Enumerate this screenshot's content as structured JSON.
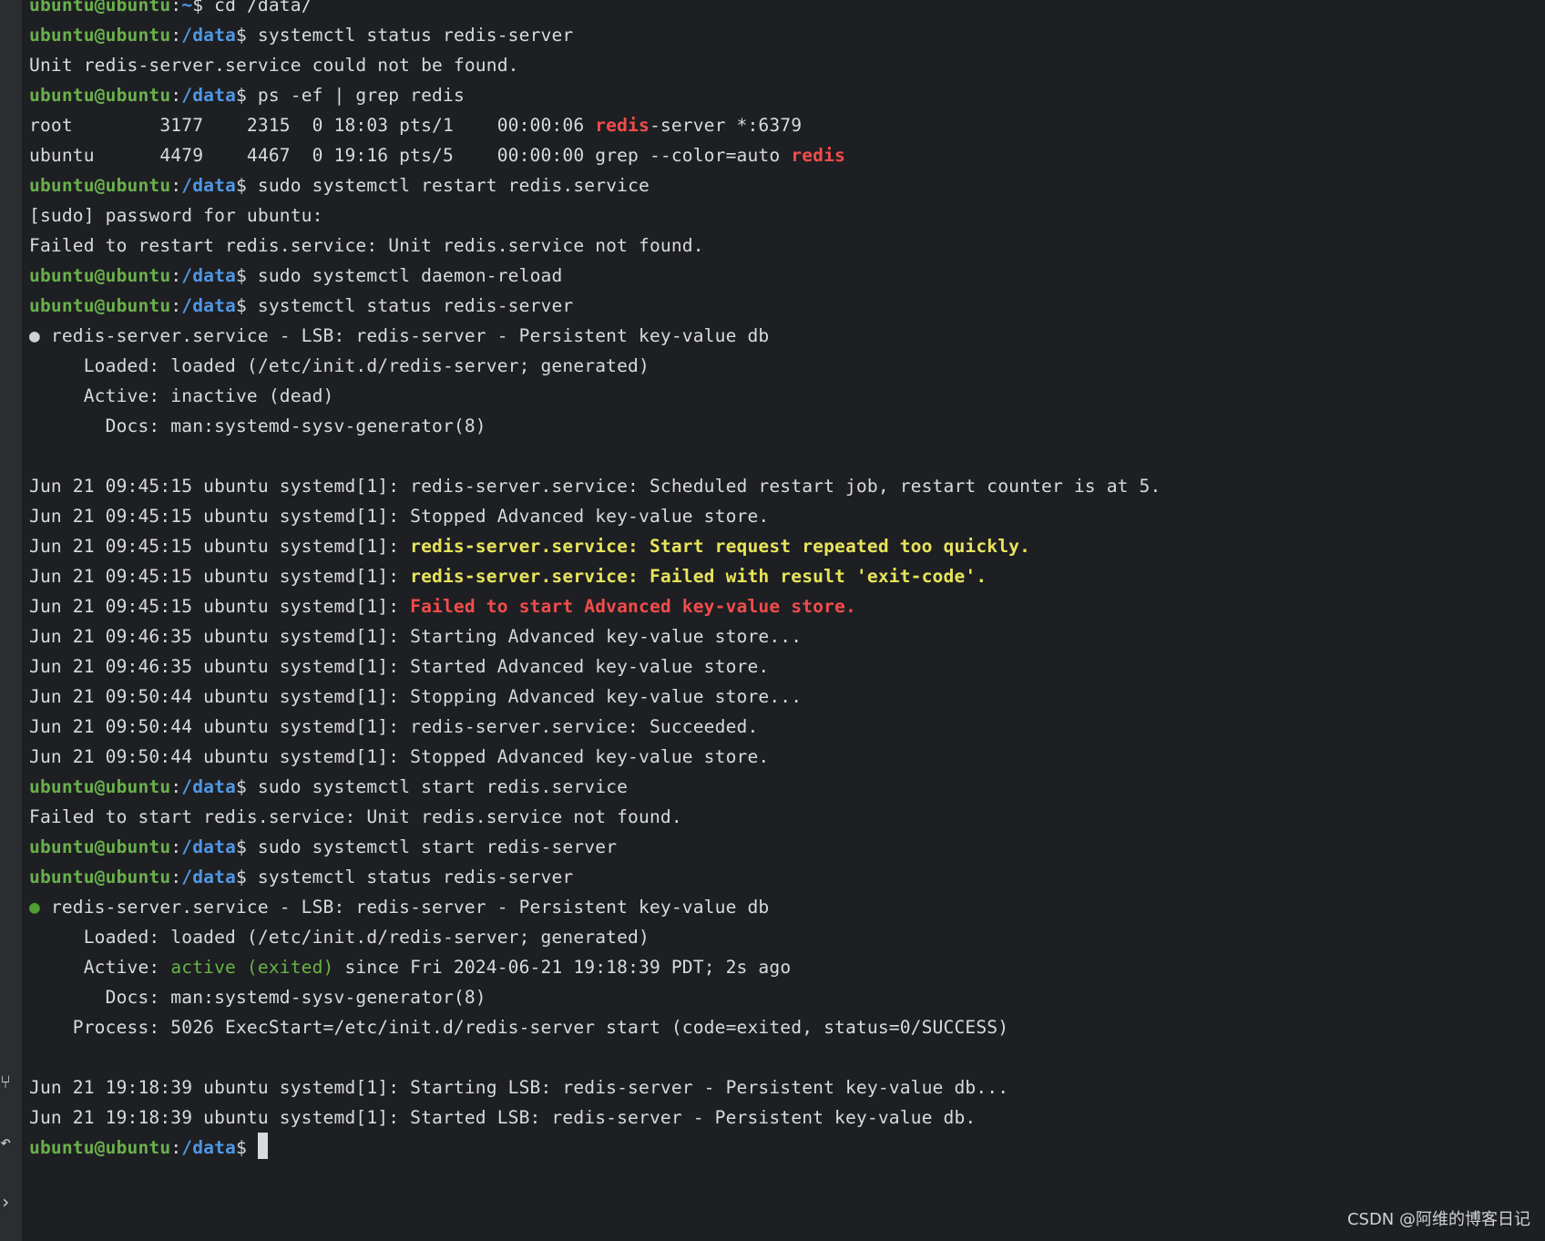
{
  "terminal": {
    "prompt_user": "ubuntu@ubuntu",
    "prompt_colon": ":",
    "prompt_path_home": "~",
    "prompt_path": "/data",
    "prompt_dollar": "$ ",
    "lines": {
      "l00": "cd /data/",
      "l01": "systemctl status redis-server",
      "l02": "Unit redis-server.service could not be found.",
      "l03": "ps -ef | grep redis",
      "l04a": "root        3177    2315  0 18:03 pts/1    00:00:06 ",
      "l04b": "redis",
      "l04c": "-server *:6379",
      "l05a": "ubuntu      4479    4467  0 19:16 pts/5    00:00:00 grep --color=auto ",
      "l05b": "redis",
      "l06": "sudo systemctl restart redis.service",
      "l07": "[sudo] password for ubuntu:",
      "l08": "Failed to restart redis.service: Unit redis.service not found.",
      "l09": "sudo systemctl daemon-reload",
      "l10": "systemctl status redis-server",
      "l11_dot": "●",
      "l11": " redis-server.service - LSB: redis-server - Persistent key-value db",
      "l12": "     Loaded: loaded (/etc/init.d/redis-server; generated)",
      "l13": "     Active: inactive (dead)",
      "l14": "       Docs: man:systemd-sysv-generator(8)",
      "l16": "Jun 21 09:45:15 ubuntu systemd[1]: redis-server.service: Scheduled restart job, restart counter is at 5.",
      "l17": "Jun 21 09:45:15 ubuntu systemd[1]: Stopped Advanced key-value store.",
      "l18a": "Jun 21 09:45:15 ubuntu systemd[1]: ",
      "l18b": "redis-server.service: Start request repeated too quickly.",
      "l19a": "Jun 21 09:45:15 ubuntu systemd[1]: ",
      "l19b": "redis-server.service: Failed with result 'exit-code'.",
      "l20a": "Jun 21 09:45:15 ubuntu systemd[1]: ",
      "l20b": "Failed to start Advanced key-value store.",
      "l21": "Jun 21 09:46:35 ubuntu systemd[1]: Starting Advanced key-value store...",
      "l22": "Jun 21 09:46:35 ubuntu systemd[1]: Started Advanced key-value store.",
      "l23": "Jun 21 09:50:44 ubuntu systemd[1]: Stopping Advanced key-value store...",
      "l24": "Jun 21 09:50:44 ubuntu systemd[1]: redis-server.service: Succeeded.",
      "l25": "Jun 21 09:50:44 ubuntu systemd[1]: Stopped Advanced key-value store.",
      "l26": "sudo systemctl start redis.service",
      "l27": "Failed to start redis.service: Unit redis.service not found.",
      "l28": "sudo systemctl start redis-server",
      "l29": "systemctl status redis-server",
      "l30_dot": "●",
      "l30": " redis-server.service - LSB: redis-server - Persistent key-value db",
      "l31": "     Loaded: loaded (/etc/init.d/redis-server; generated)",
      "l32a": "     Active: ",
      "l32b": "active (exited)",
      "l32c": " since Fri 2024-06-21 19:18:39 PDT; 2s ago",
      "l33": "       Docs: man:systemd-sysv-generator(8)",
      "l34": "    Process: 5026 ExecStart=/etc/init.d/redis-server start (code=exited, status=0/SUCCESS)",
      "l36": "Jun 21 19:18:39 ubuntu systemd[1]: Starting LSB: redis-server - Persistent key-value db...",
      "l37": "Jun 21 19:18:39 ubuntu systemd[1]: Started LSB: redis-server - Persistent key-value db."
    }
  },
  "colors": {
    "background": "#1e1f22",
    "prompt_user": "#6ab04c",
    "prompt_path": "#4f97e5",
    "match_red": "#f14c4c",
    "warning_yellow": "#e7e45b",
    "active_green": "#65b545"
  },
  "gutter_icons": [
    "terminal-tool-icon",
    "undo-icon",
    "chevron-right-icon"
  ],
  "watermark": "CSDN @阿维的博客日记"
}
